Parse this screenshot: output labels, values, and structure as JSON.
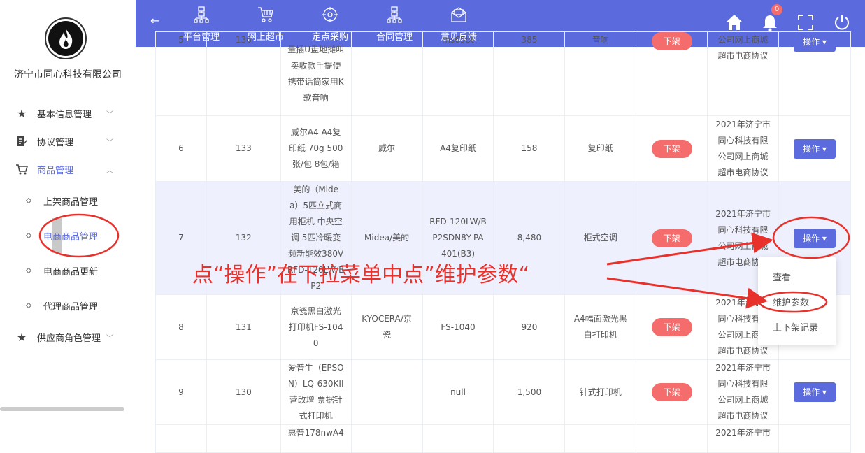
{
  "sidebar": {
    "company": "济宁市同心科技有限公司",
    "items": [
      {
        "icon": "star-icon",
        "label": "基本信息管理"
      },
      {
        "icon": "edit-doc-icon",
        "label": "协议管理"
      },
      {
        "icon": "cart-icon",
        "label": "商品管理"
      },
      {
        "label": "上架商品管理"
      },
      {
        "label": "电商商品管理"
      },
      {
        "label": "电商商品更新"
      },
      {
        "label": "代理商品管理"
      },
      {
        "icon": "star-icon",
        "label": "供应商角色管理"
      }
    ]
  },
  "topbar": {
    "nav": [
      {
        "icon": "org-chart-icon",
        "label": "平台管理"
      },
      {
        "icon": "shopping-cart-icon",
        "label": "网上超市"
      },
      {
        "icon": "crosshair-icon",
        "label": "定点采购"
      },
      {
        "icon": "org-chart-icon",
        "label": "合同管理"
      },
      {
        "icon": "mail-icon",
        "label": "意见反馈"
      }
    ],
    "badge": "0"
  },
  "table": {
    "status": "下架",
    "op": "操作",
    "rows": [
      {
        "no": "5",
        "id": "136",
        "name": "量插U盘地摊叫\n卖收款手提便\n携带话筒家用K\n歌音响",
        "brand": "",
        "model": "ms65bt",
        "price": "385",
        "category": "音响",
        "protocol": "公司网上商城\n超市电商协议"
      },
      {
        "no": "6",
        "id": "133",
        "name": "威尔A4 A4复\n印纸 70g 500\n张/包 8包/箱",
        "brand": "威尔",
        "model": "A4复印纸",
        "price": "158",
        "category": "复印纸",
        "protocol": "2021年济宁市\n同心科技有限\n公司网上商城\n超市电商协议"
      },
      {
        "no": "7",
        "id": "132",
        "name": "美的（Mide\na）5匹立式商\n用柜机 中央空\n调 5匹冷暖变\n频新能效380V\nRFD-120LW/B\nP2",
        "brand": "Midea/美的",
        "model": "RFD-120LW/B\nP2SDN8Y-PA\n401(B3)",
        "price": "8,480",
        "category": "柜式空调",
        "protocol": "2021年济宁市\n同心科技有限\n公司网上商城\n超市电商协议"
      },
      {
        "no": "8",
        "id": "131",
        "name": "京瓷黑白激光\n打印机FS-104\n0",
        "brand": "KYOCERA/京\n瓷",
        "model": "FS-1040",
        "price": "920",
        "category": "A4幅面激光黑\n白打印机",
        "protocol": "2021年济宁市\n同心科技有限\n公司网上商城\n超市电商协议"
      },
      {
        "no": "9",
        "id": "130",
        "name": "爱普生（EPSO\nN）LQ-630KII\n营改增 票据针\n式打印机",
        "brand": "",
        "model": "null",
        "price": "1,500",
        "category": "针式打印机",
        "protocol": "2021年济宁市\n同心科技有限\n公司网上商城\n超市电商协议"
      },
      {
        "no": "",
        "id": "",
        "name": "惠普178nwA4",
        "brand": "",
        "model": "",
        "price": "",
        "category": "",
        "protocol": "2021年济宁市"
      }
    ]
  },
  "popup": {
    "items": [
      "查看",
      "维护参数",
      "上下架记录"
    ]
  },
  "annotation": "点“操作”在下拉菜单中点”维护参数“"
}
